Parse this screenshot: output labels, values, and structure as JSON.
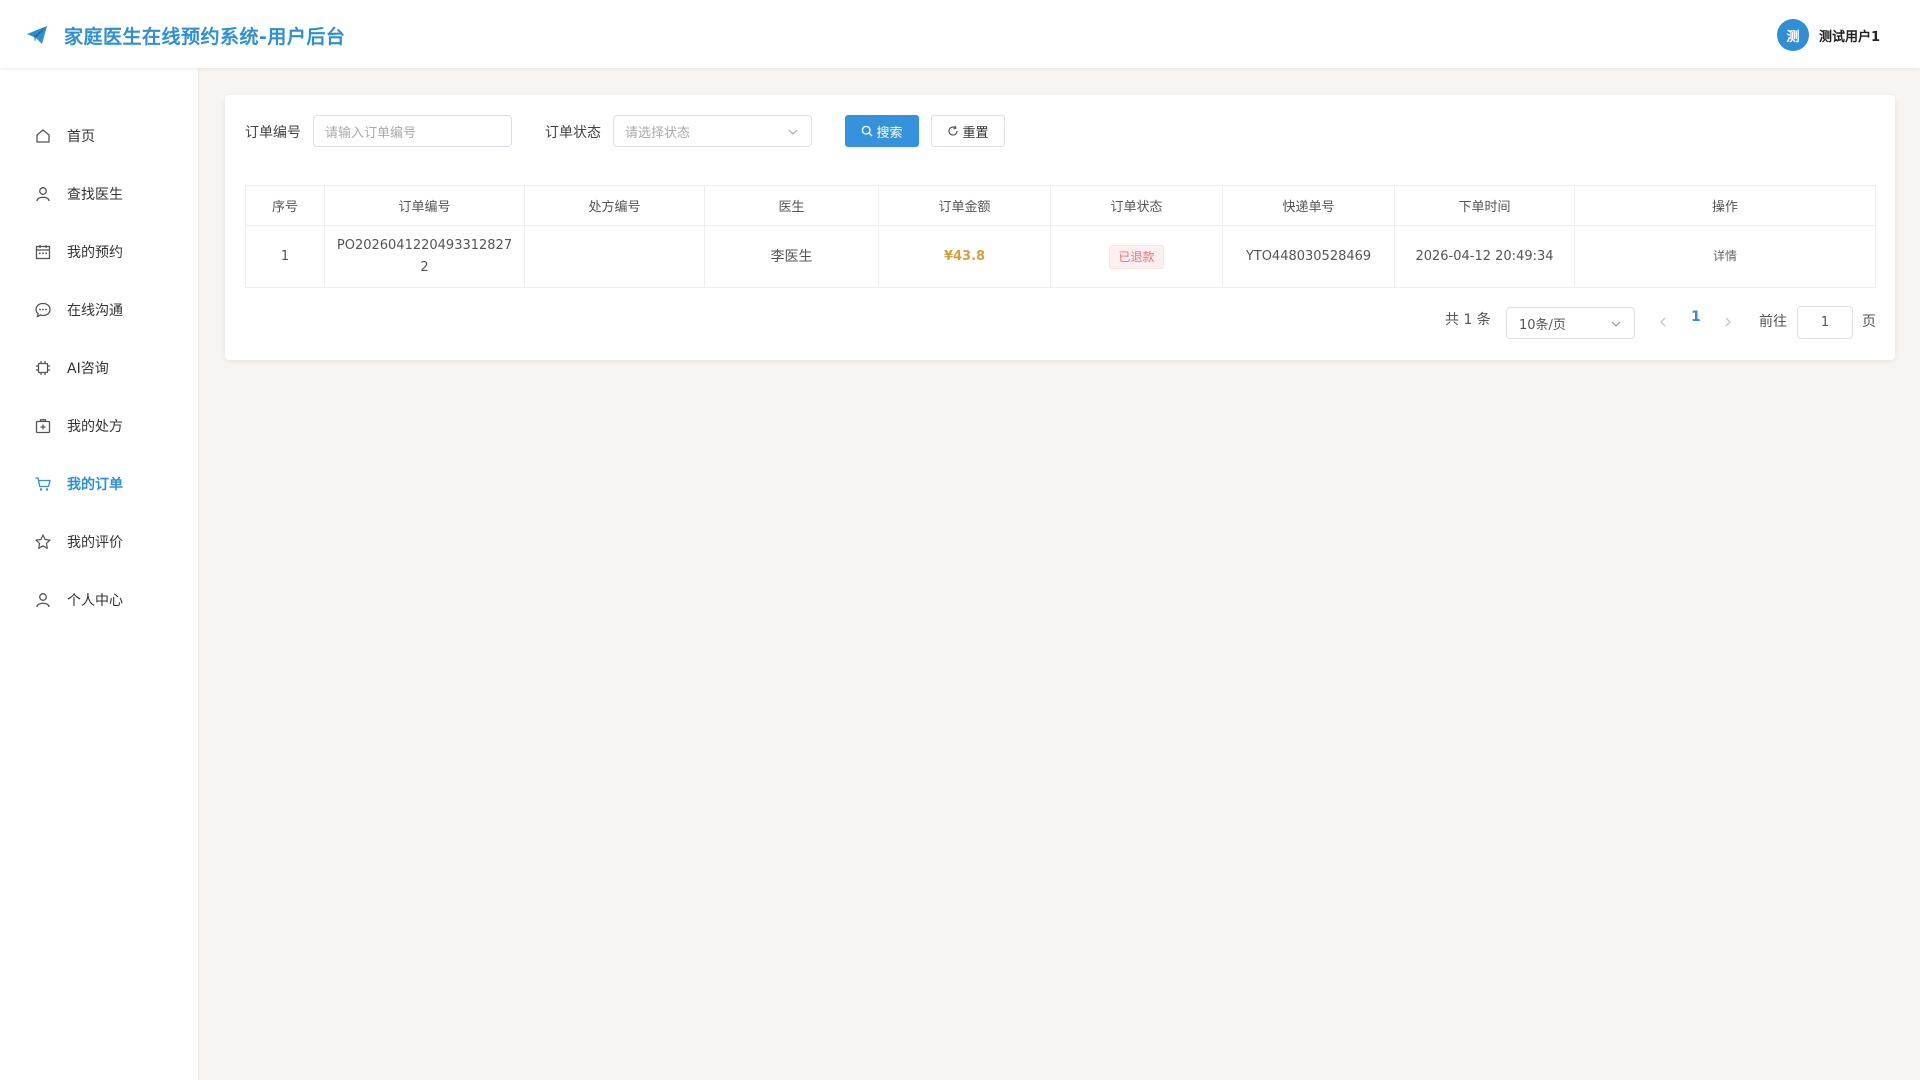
{
  "header": {
    "title": "家庭医生在线预约系统-用户后台",
    "avatar_text": "测",
    "username": "测试用户1"
  },
  "sidebar": {
    "active_index": 6,
    "items": [
      {
        "label": "首页",
        "icon": "home-icon"
      },
      {
        "label": "查找医生",
        "icon": "user-icon"
      },
      {
        "label": "我的预约",
        "icon": "calendar-icon"
      },
      {
        "label": "在线沟通",
        "icon": "chat-icon"
      },
      {
        "label": "AI咨询",
        "icon": "chip-icon"
      },
      {
        "label": "我的处方",
        "icon": "first-aid-icon"
      },
      {
        "label": "我的订单",
        "icon": "cart-icon"
      },
      {
        "label": "我的评价",
        "icon": "star-icon"
      },
      {
        "label": "个人中心",
        "icon": "user-icon"
      }
    ]
  },
  "filters": {
    "order_no_label": "订单编号",
    "order_no_placeholder": "请输入订单编号",
    "status_label": "订单状态",
    "status_placeholder": "请选择状态",
    "search_label": "搜索",
    "reset_label": "重置"
  },
  "table": {
    "columns": [
      "序号",
      "订单编号",
      "处方编号",
      "医生",
      "订单金额",
      "订单状态",
      "快递单号",
      "下单时间",
      "操作"
    ],
    "rows": [
      {
        "index": "1",
        "order_no": "PO20260412204933128272",
        "prescription_no": "",
        "doctor": "李医生",
        "amount": "¥43.8",
        "status": "已退款",
        "tracking_no": "YTO448030528469",
        "created_at": "2026-04-12 20:49:34",
        "action": "详情"
      }
    ]
  },
  "pagination": {
    "total_text": "共 1 条",
    "page_size": "10条/页",
    "current_page": "1",
    "goto_label": "前往",
    "goto_value": "1",
    "page_suffix": "页"
  },
  "colors": {
    "primary": "#2f8fd5",
    "money": "#d4a23c",
    "status_refunded": "#f56c6c"
  }
}
